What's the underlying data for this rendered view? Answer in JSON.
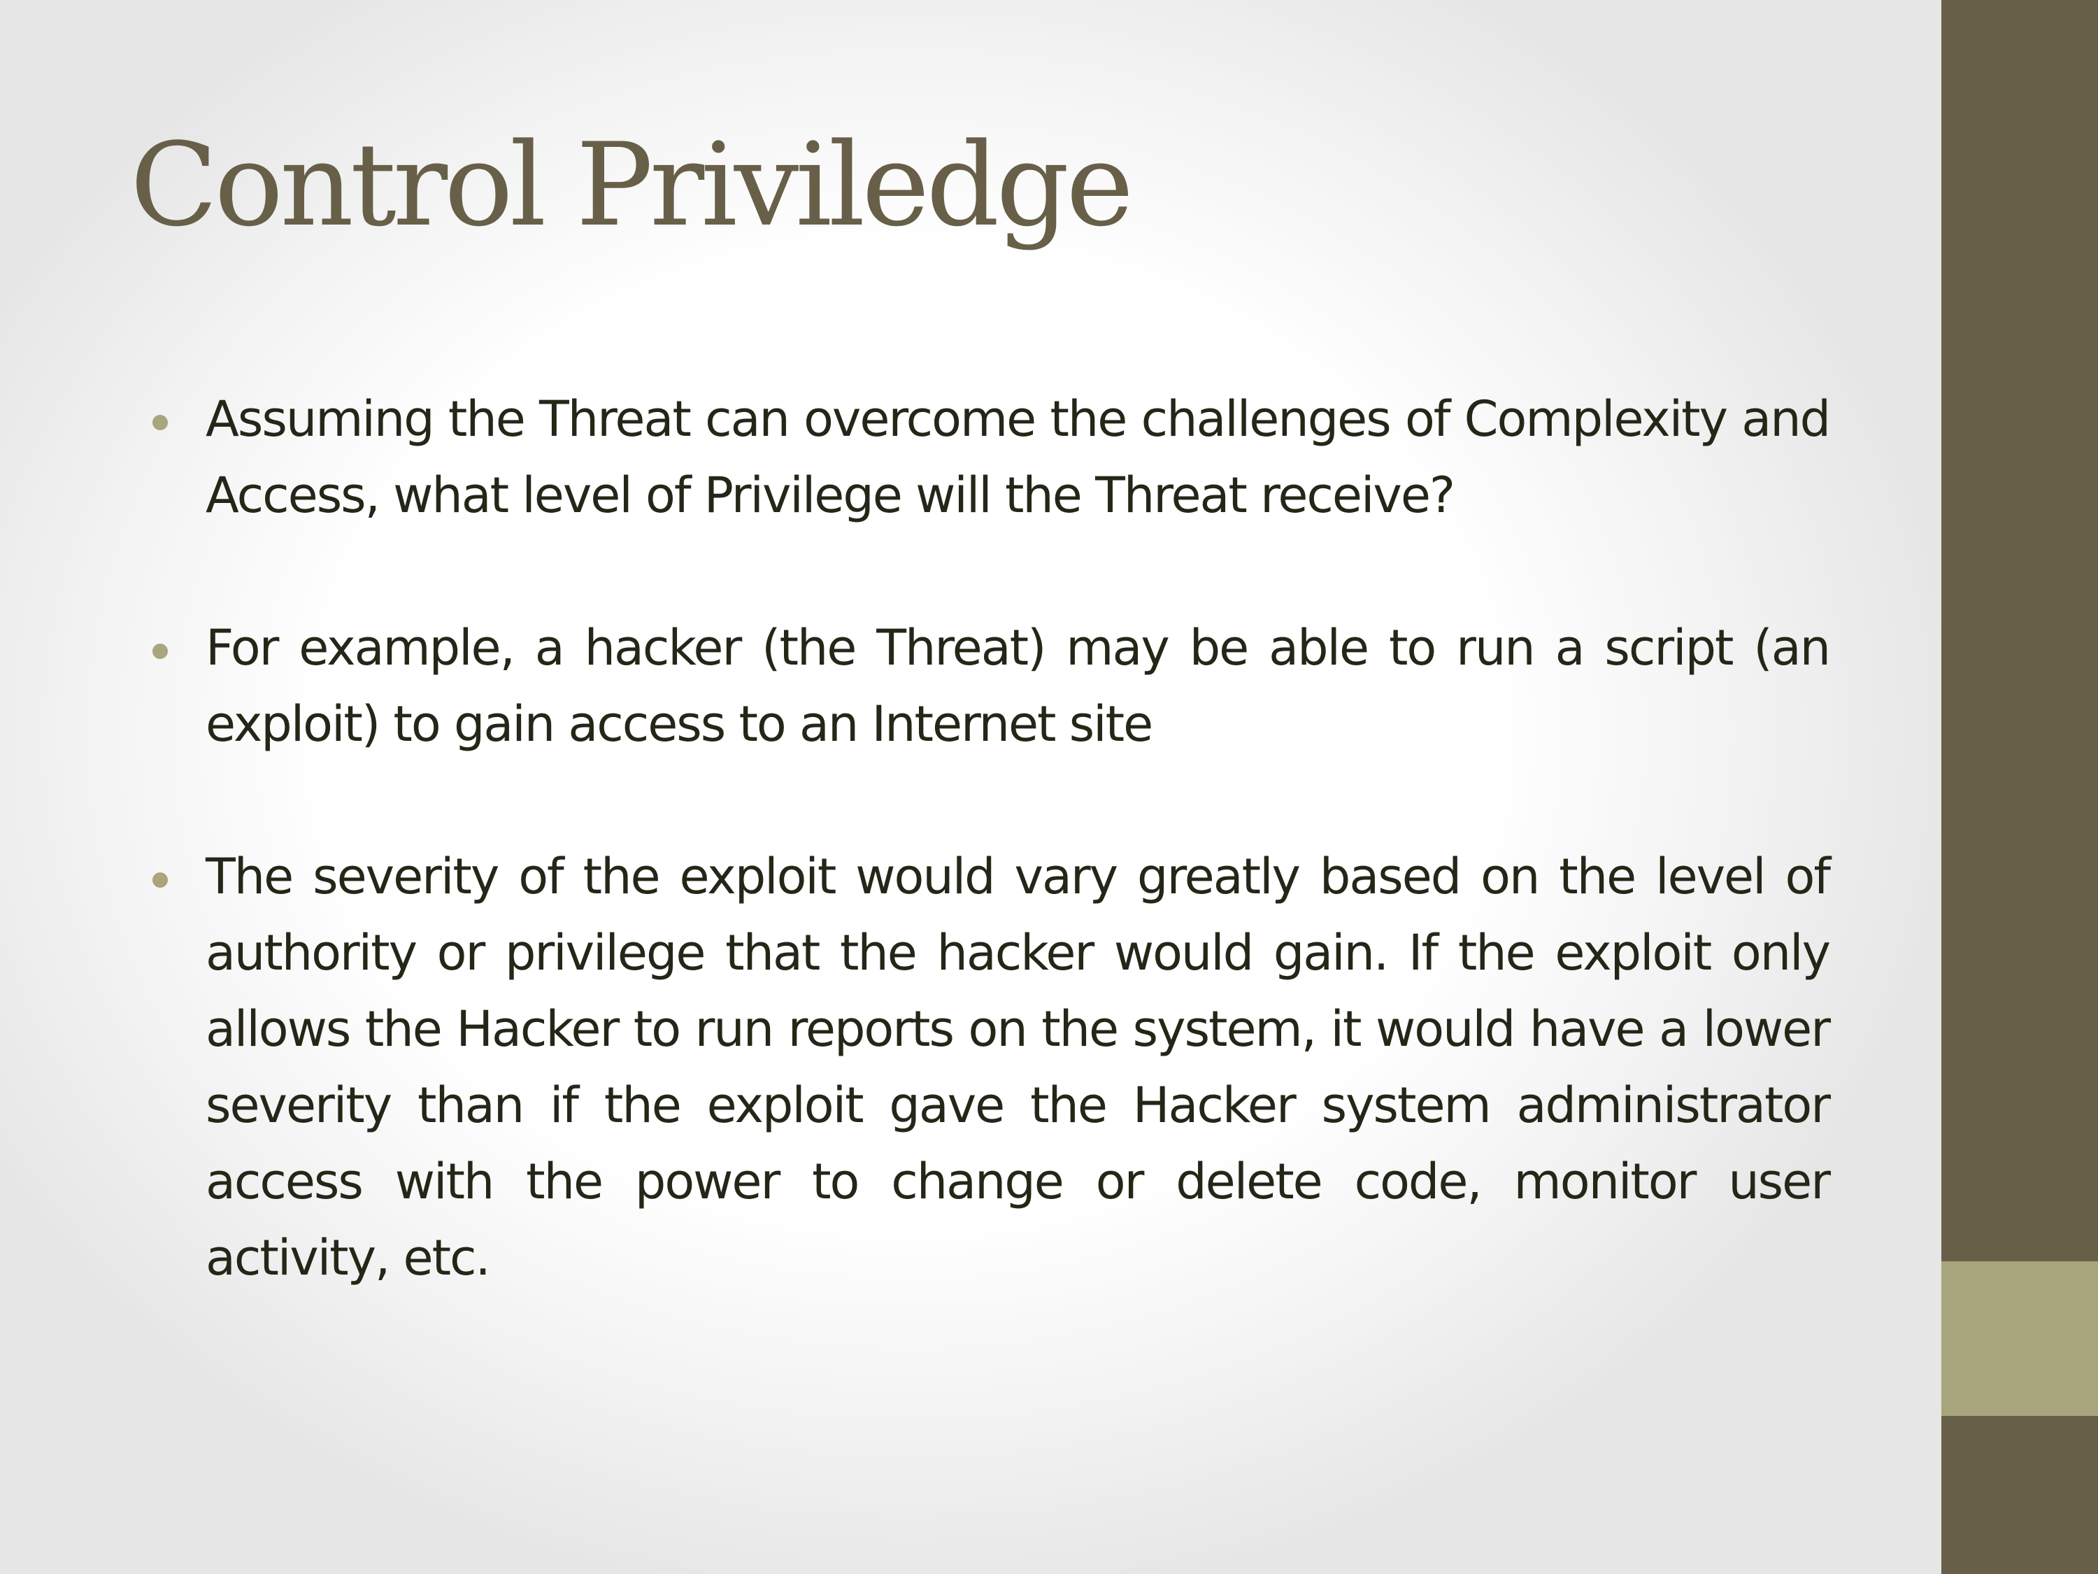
{
  "slide": {
    "title": "Control Priviledge",
    "bullets": [
      "Assuming the Threat can overcome the challenges of Complexity and Access, what level of Privilege will the Threat receive?",
      "For example, a hacker (the Threat) may be able to run a script (an exploit) to gain access to an Internet site",
      "The severity of the exploit would vary greatly based on the level of authority or privilege that the hacker would gain. If the exploit only allows the Hacker to run reports on the system, it would have a lower severity than if the exploit gave the Hacker system administrator access with the power to change or delete code, monitor user activity, etc."
    ]
  },
  "colors": {
    "title": "#675f48",
    "sidebar": "#675f48",
    "sidebar_accent": "#a9a57c",
    "bullet_marker": "#a9a57c",
    "body_text": "#262618"
  }
}
